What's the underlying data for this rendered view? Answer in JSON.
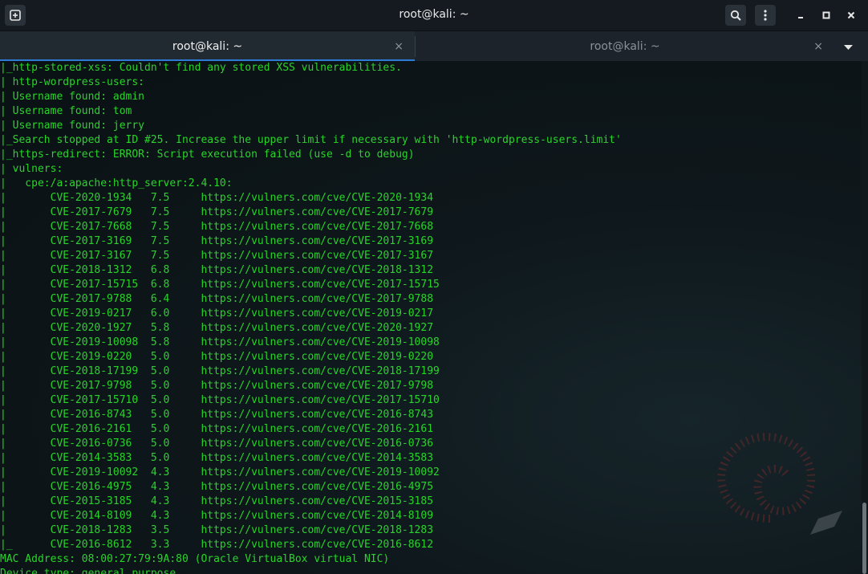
{
  "window": {
    "title": "root@kali: ~"
  },
  "tabs": [
    {
      "label": "root@kali: ~",
      "close": "×"
    },
    {
      "label": "root@kali: ~",
      "close": "×"
    }
  ],
  "icons": {
    "new_tab": "new-tab-icon",
    "search": "search-icon",
    "menu": "kebab-menu-icon",
    "minimize": "minimize-icon",
    "maximize": "maximize-icon",
    "close": "close-icon",
    "dropdown": "chevron-down-icon"
  },
  "colors": {
    "terminal_text": "#29d42a",
    "tab_accent": "#2e7bd6"
  },
  "terminal": {
    "lines": [
      "|_http-stored-xss: Couldn't find any stored XSS vulnerabilities.",
      "| http-wordpress-users:",
      "| Username found: admin",
      "| Username found: tom",
      "| Username found: jerry",
      "|_Search stopped at ID #25. Increase the upper limit if necessary with 'http-wordpress-users.limit'",
      "|_https-redirect: ERROR: Script execution failed (use -d to debug)",
      "| vulners:",
      "|   cpe:/a:apache:http_server:2.4.10:",
      "|       CVE-2020-1934   7.5     https://vulners.com/cve/CVE-2020-1934",
      "|       CVE-2017-7679   7.5     https://vulners.com/cve/CVE-2017-7679",
      "|       CVE-2017-7668   7.5     https://vulners.com/cve/CVE-2017-7668",
      "|       CVE-2017-3169   7.5     https://vulners.com/cve/CVE-2017-3169",
      "|       CVE-2017-3167   7.5     https://vulners.com/cve/CVE-2017-3167",
      "|       CVE-2018-1312   6.8     https://vulners.com/cve/CVE-2018-1312",
      "|       CVE-2017-15715  6.8     https://vulners.com/cve/CVE-2017-15715",
      "|       CVE-2017-9788   6.4     https://vulners.com/cve/CVE-2017-9788",
      "|       CVE-2019-0217   6.0     https://vulners.com/cve/CVE-2019-0217",
      "|       CVE-2020-1927   5.8     https://vulners.com/cve/CVE-2020-1927",
      "|       CVE-2019-10098  5.8     https://vulners.com/cve/CVE-2019-10098",
      "|       CVE-2019-0220   5.0     https://vulners.com/cve/CVE-2019-0220",
      "|       CVE-2018-17199  5.0     https://vulners.com/cve/CVE-2018-17199",
      "|       CVE-2017-9798   5.0     https://vulners.com/cve/CVE-2017-9798",
      "|       CVE-2017-15710  5.0     https://vulners.com/cve/CVE-2017-15710",
      "|       CVE-2016-8743   5.0     https://vulners.com/cve/CVE-2016-8743",
      "|       CVE-2016-2161   5.0     https://vulners.com/cve/CVE-2016-2161",
      "|       CVE-2016-0736   5.0     https://vulners.com/cve/CVE-2016-0736",
      "|       CVE-2014-3583   5.0     https://vulners.com/cve/CVE-2014-3583",
      "|       CVE-2019-10092  4.3     https://vulners.com/cve/CVE-2019-10092",
      "|       CVE-2016-4975   4.3     https://vulners.com/cve/CVE-2016-4975",
      "|       CVE-2015-3185   4.3     https://vulners.com/cve/CVE-2015-3185",
      "|       CVE-2014-8109   4.3     https://vulners.com/cve/CVE-2014-8109",
      "|       CVE-2018-1283   3.5     https://vulners.com/cve/CVE-2018-1283",
      "|_      CVE-2016-8612   3.3     https://vulners.com/cve/CVE-2016-8612",
      "MAC Address: 08:00:27:79:9A:80 (Oracle VirtualBox virtual NIC)",
      "Device type: general purpose"
    ]
  }
}
